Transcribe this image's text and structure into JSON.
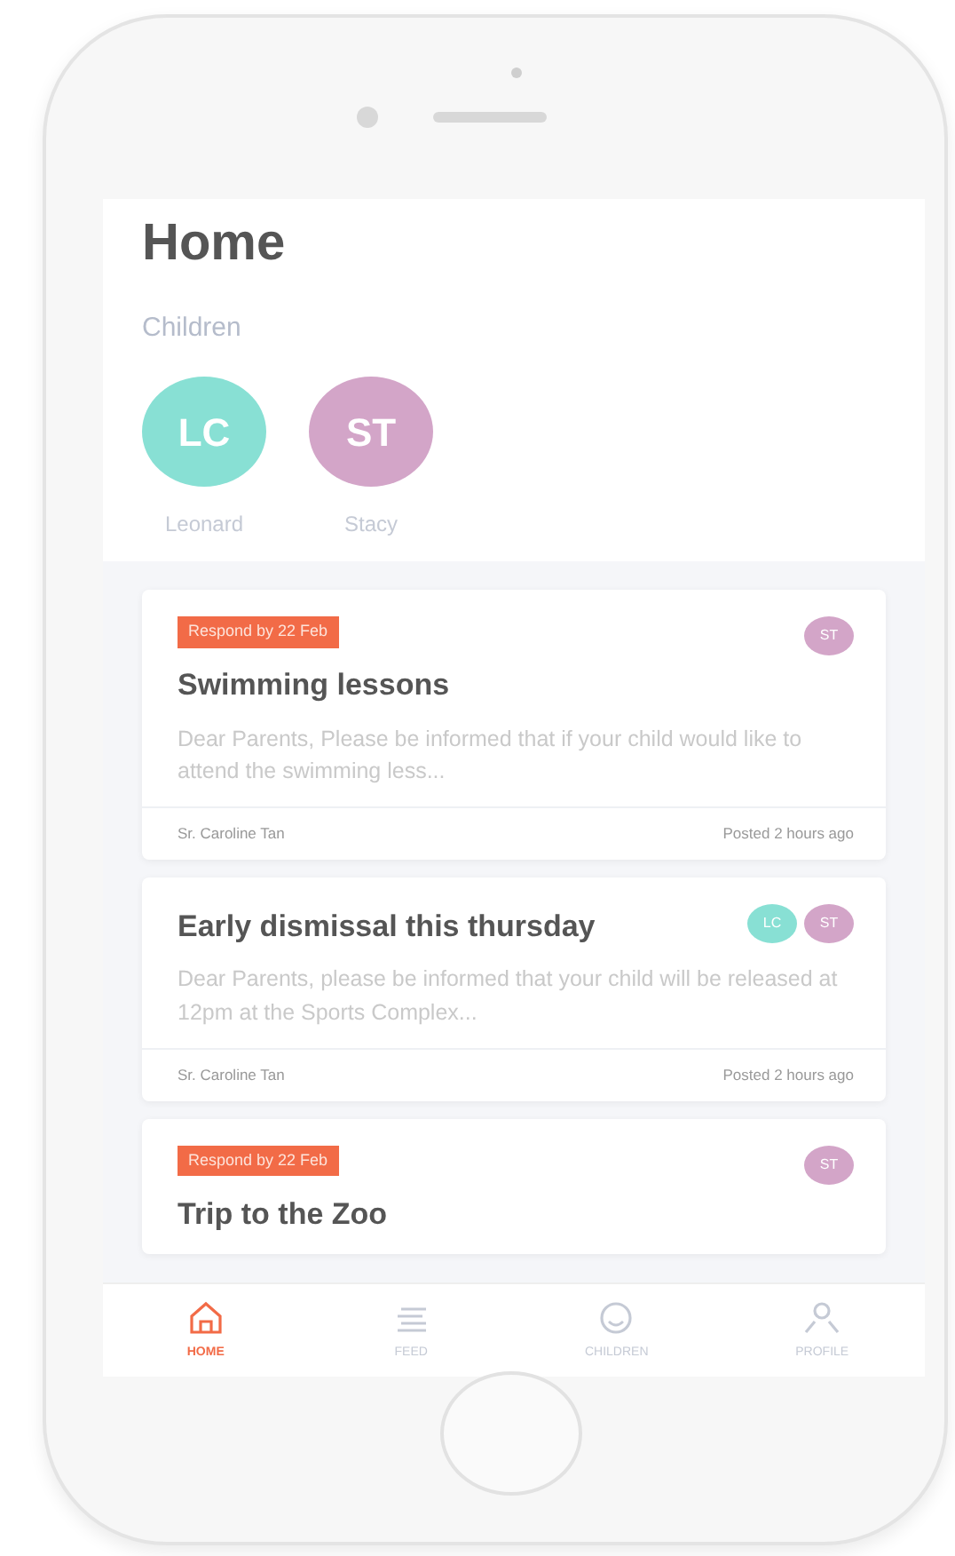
{
  "screen": {
    "title": "Home",
    "children_label": "Children"
  },
  "children": [
    {
      "initials": "LC",
      "name": "Leonard",
      "color": "#88e0d4"
    },
    {
      "initials": "ST",
      "name": "Stacy",
      "color": "#d3a5c8"
    }
  ],
  "notices": [
    {
      "tag": "Respond by 22 Feb",
      "title": "Swimming lessons",
      "body": "Dear Parents, Please be informed that if your child would like to attend the swimming less...",
      "author": "Sr. Caroline Tan",
      "posted": "Posted 2 hours ago",
      "children": [
        {
          "initials": "ST",
          "color": "#d3a5c8"
        }
      ]
    },
    {
      "title": "Early dismissal this thursday",
      "body": "Dear Parents, please be informed that your child will be released at 12pm at the Sports Complex...",
      "author": "Sr. Caroline Tan",
      "posted": "Posted 2 hours ago",
      "children": [
        {
          "initials": "LC",
          "color": "#88e0d4"
        },
        {
          "initials": "ST",
          "color": "#d3a5c8"
        }
      ]
    },
    {
      "tag": "Respond by 22 Feb",
      "title": "Trip to the Zoo",
      "children": [
        {
          "initials": "ST",
          "color": "#d3a5c8"
        }
      ]
    }
  ],
  "tabs": [
    {
      "label": "HOME",
      "selected": true
    },
    {
      "label": "FEED",
      "selected": false
    },
    {
      "label": "CHILDREN",
      "selected": false
    },
    {
      "label": "PROFILE",
      "selected": false
    }
  ]
}
